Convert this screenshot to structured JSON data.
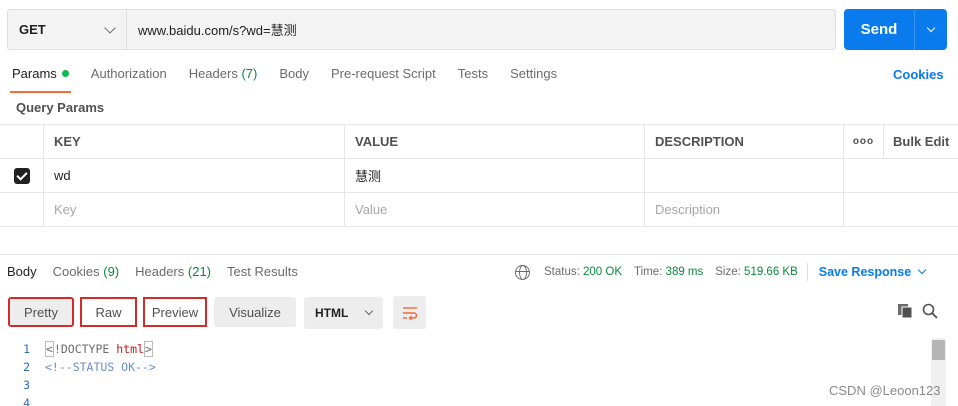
{
  "request": {
    "method": "GET",
    "url": "www.baidu.com/s?wd=慧测",
    "send_label": "Send"
  },
  "request_tabs": [
    {
      "label": "Params",
      "active": true,
      "has_dot": true
    },
    {
      "label": "Authorization"
    },
    {
      "label": "Headers",
      "count": "(7)"
    },
    {
      "label": "Body"
    },
    {
      "label": "Pre-request Script"
    },
    {
      "label": "Tests"
    },
    {
      "label": "Settings"
    }
  ],
  "cookies_label": "Cookies",
  "query_params": {
    "title": "Query Params",
    "headers": {
      "key": "KEY",
      "value": "VALUE",
      "description": "DESCRIPTION",
      "more": "ooo",
      "bulk_edit": "Bulk Edit"
    },
    "rows": [
      {
        "checked": true,
        "key": "wd",
        "value": "慧测",
        "description": ""
      }
    ],
    "placeholders": {
      "key": "Key",
      "value": "Value",
      "description": "Description"
    }
  },
  "response_tabs": [
    {
      "label": "Body",
      "active": true
    },
    {
      "label": "Cookies",
      "count": "(9)"
    },
    {
      "label": "Headers",
      "count": "(21)"
    },
    {
      "label": "Test Results"
    }
  ],
  "response_meta": {
    "status_label": "Status:",
    "status_value": "200 OK",
    "time_label": "Time:",
    "time_value": "389 ms",
    "size_label": "Size:",
    "size_value": "519.66 KB",
    "save_label": "Save Response"
  },
  "format_buttons": {
    "pretty": "Pretty",
    "raw": "Raw",
    "preview": "Preview",
    "visualize": "Visualize",
    "language": "HTML"
  },
  "code_lines": [
    {
      "num": "1",
      "prefix": "<",
      "text_a": "!DOCTYPE ",
      "text_b": "html",
      "suffix": ">"
    },
    {
      "num": "2",
      "comment": "<!--STATUS OK-->"
    },
    {
      "num": "3"
    },
    {
      "num": "4"
    }
  ],
  "watermark": "CSDN @Leoon123",
  "colors": {
    "accent": "#097bed",
    "active_tab_underline": "#f26b3a",
    "status_green": "#0a8a3c",
    "highlight_box": "#d32a2a"
  },
  "icons": [
    "chevron-down-icon",
    "globe-icon",
    "wrap-lines-icon",
    "copy-icon",
    "search-icon",
    "checkbox-checked-icon"
  ]
}
